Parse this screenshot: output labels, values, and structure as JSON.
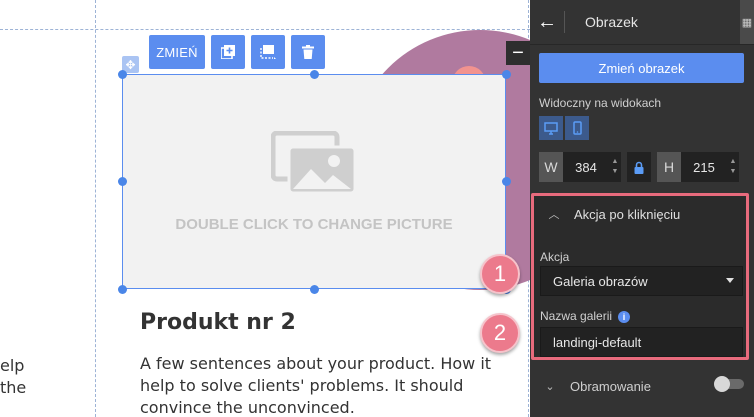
{
  "canvas": {
    "toolbar": {
      "change_label": "ZMIEŃ"
    },
    "picture": {
      "caption": "DOUBLE CLICK TO CHANGE PICTURE"
    },
    "heading": "Produkt nr 2",
    "paragraph": "A few sentences about your product. How it help to solve clients' problems. It should convince the unconvinced.",
    "leftover_lines": [
      "elp",
      "the"
    ],
    "collapse_symbol": "−"
  },
  "panel": {
    "title": "Obrazek",
    "change_image_button": "Zmień obrazek",
    "visible_label": "Widoczny na widokach",
    "width_label": "W",
    "width_value": "384",
    "height_label": "H",
    "height_value": "215",
    "click_action_section": {
      "title": "Akcja po kliknięciu",
      "action_label": "Akcja",
      "action_value": "Galeria obrazów",
      "gallery_label": "Nazwa galerii",
      "gallery_value": "landingi-default"
    },
    "frame_section": {
      "title": "Obramowanie",
      "enabled": false
    }
  },
  "badges": [
    "1",
    "2"
  ],
  "colors": {
    "accent": "#5b8def",
    "panel_bg": "#333333",
    "highlight": "#e86b7d",
    "badge": "#ec7a8c"
  }
}
